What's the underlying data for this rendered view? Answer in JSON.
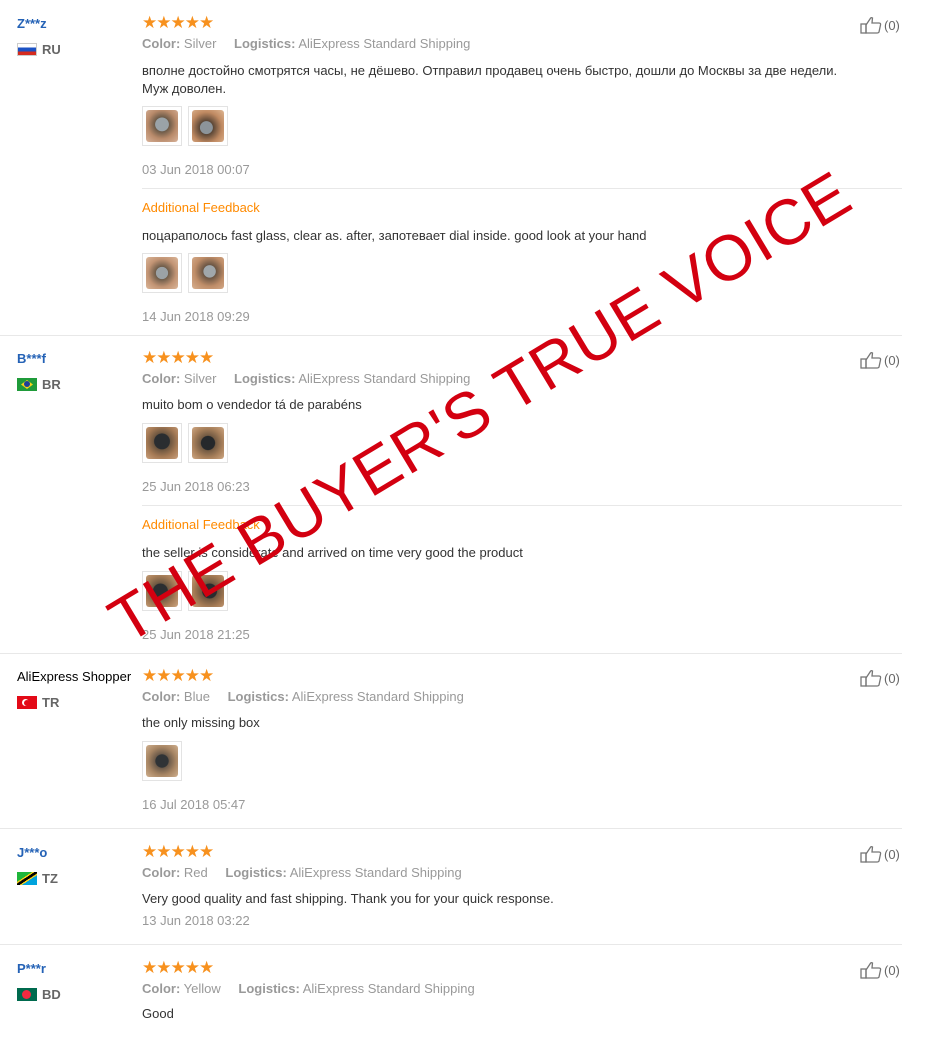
{
  "reviews": [
    {
      "user": "Z***z",
      "country": "RU",
      "stars": "★★★★★",
      "color_label": "Color:",
      "color": "Silver",
      "logistics_label": "Logistics:",
      "logistics": "AliExpress Standard Shipping",
      "text_line1": "вполне достойно смотрятся часы, не дёшево. Отправил продавец очень быстро, дошли до Москвы за две недели.",
      "text_line2": "Муж доволен.",
      "date": "03 Jun 2018 00:07",
      "like": "(0)",
      "additional_label": "Additional Feedback",
      "additional_text": "поцараполось fast glass, clear as. after, запотевает dial inside. good look at your hand",
      "additional_date": "14 Jun 2018 09:29"
    },
    {
      "user": "B***f",
      "country": "BR",
      "stars": "★★★★★",
      "color_label": "Color:",
      "color": "Silver",
      "logistics_label": "Logistics:",
      "logistics": "AliExpress Standard Shipping",
      "text_line1": "muito bom o vendedor tá de parabéns",
      "date": "25 Jun 2018 06:23",
      "like": "(0)",
      "additional_label": "Additional Feedback",
      "additional_text": "the seller is considerate and arrived on time very good the product",
      "additional_date": "25 Jun 2018 21:25"
    },
    {
      "user": "AliExpress Shopper",
      "country": "TR",
      "stars": "★★★★★",
      "color_label": "Color:",
      "color": "Blue",
      "logistics_label": "Logistics:",
      "logistics": "AliExpress Standard Shipping",
      "text_line1": "the only missing box",
      "date": "16 Jul 2018 05:47",
      "like": "(0)"
    },
    {
      "user": "J***o",
      "country": "TZ",
      "stars": "★★★★★",
      "color_label": "Color:",
      "color": "Red",
      "logistics_label": "Logistics:",
      "logistics": "AliExpress Standard Shipping",
      "text_line1": "Very good quality and fast shipping. Thank you for your quick response.",
      "date": "13 Jun 2018 03:22",
      "like": "(0)"
    },
    {
      "user": "P***r",
      "country": "BD",
      "stars": "★★★★★",
      "color_label": "Color:",
      "color": "Yellow",
      "logistics_label": "Logistics:",
      "logistics": "AliExpress Standard Shipping",
      "text_line1": "Good",
      "like": "(0)"
    }
  ],
  "watermark": "THE BUYER'S TRUE VOICE",
  "colors": {
    "link": "#2462b6",
    "star": "#f7911e",
    "additional": "#ff8a00",
    "watermark": "#d30010"
  },
  "icons": {
    "like": "thumbs-up-icon"
  }
}
